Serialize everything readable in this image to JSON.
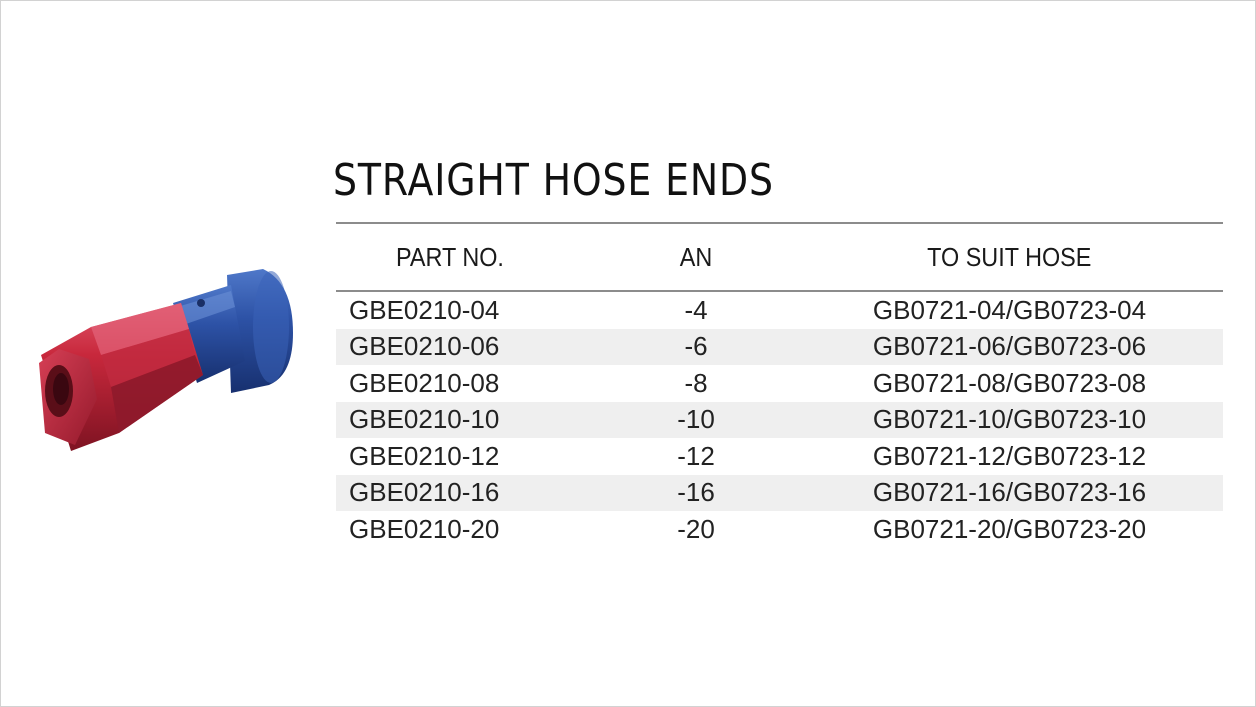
{
  "title": "STRAIGHT HOSE ENDS",
  "product_image": {
    "icon": "hose-end-fitting-icon",
    "colors": {
      "red": "#c8283c",
      "blue": "#2d52a6"
    }
  },
  "table": {
    "headers": {
      "part_no": "PART NO.",
      "an": "AN",
      "to_suit_hose": "TO SUIT HOSE"
    },
    "rows": [
      {
        "part_no": "GBE0210-04",
        "an": "-4",
        "to_suit_hose": "GB0721-04/GB0723-04"
      },
      {
        "part_no": "GBE0210-06",
        "an": "-6",
        "to_suit_hose": "GB0721-06/GB0723-06"
      },
      {
        "part_no": "GBE0210-08",
        "an": "-8",
        "to_suit_hose": "GB0721-08/GB0723-08"
      },
      {
        "part_no": "GBE0210-10",
        "an": "-10",
        "to_suit_hose": "GB0721-10/GB0723-10"
      },
      {
        "part_no": "GBE0210-12",
        "an": "-12",
        "to_suit_hose": "GB0721-12/GB0723-12"
      },
      {
        "part_no": "GBE0210-16",
        "an": "-16",
        "to_suit_hose": "GB0721-16/GB0723-16"
      },
      {
        "part_no": "GBE0210-20",
        "an": "-20",
        "to_suit_hose": "GB0721-20/GB0723-20"
      }
    ]
  }
}
